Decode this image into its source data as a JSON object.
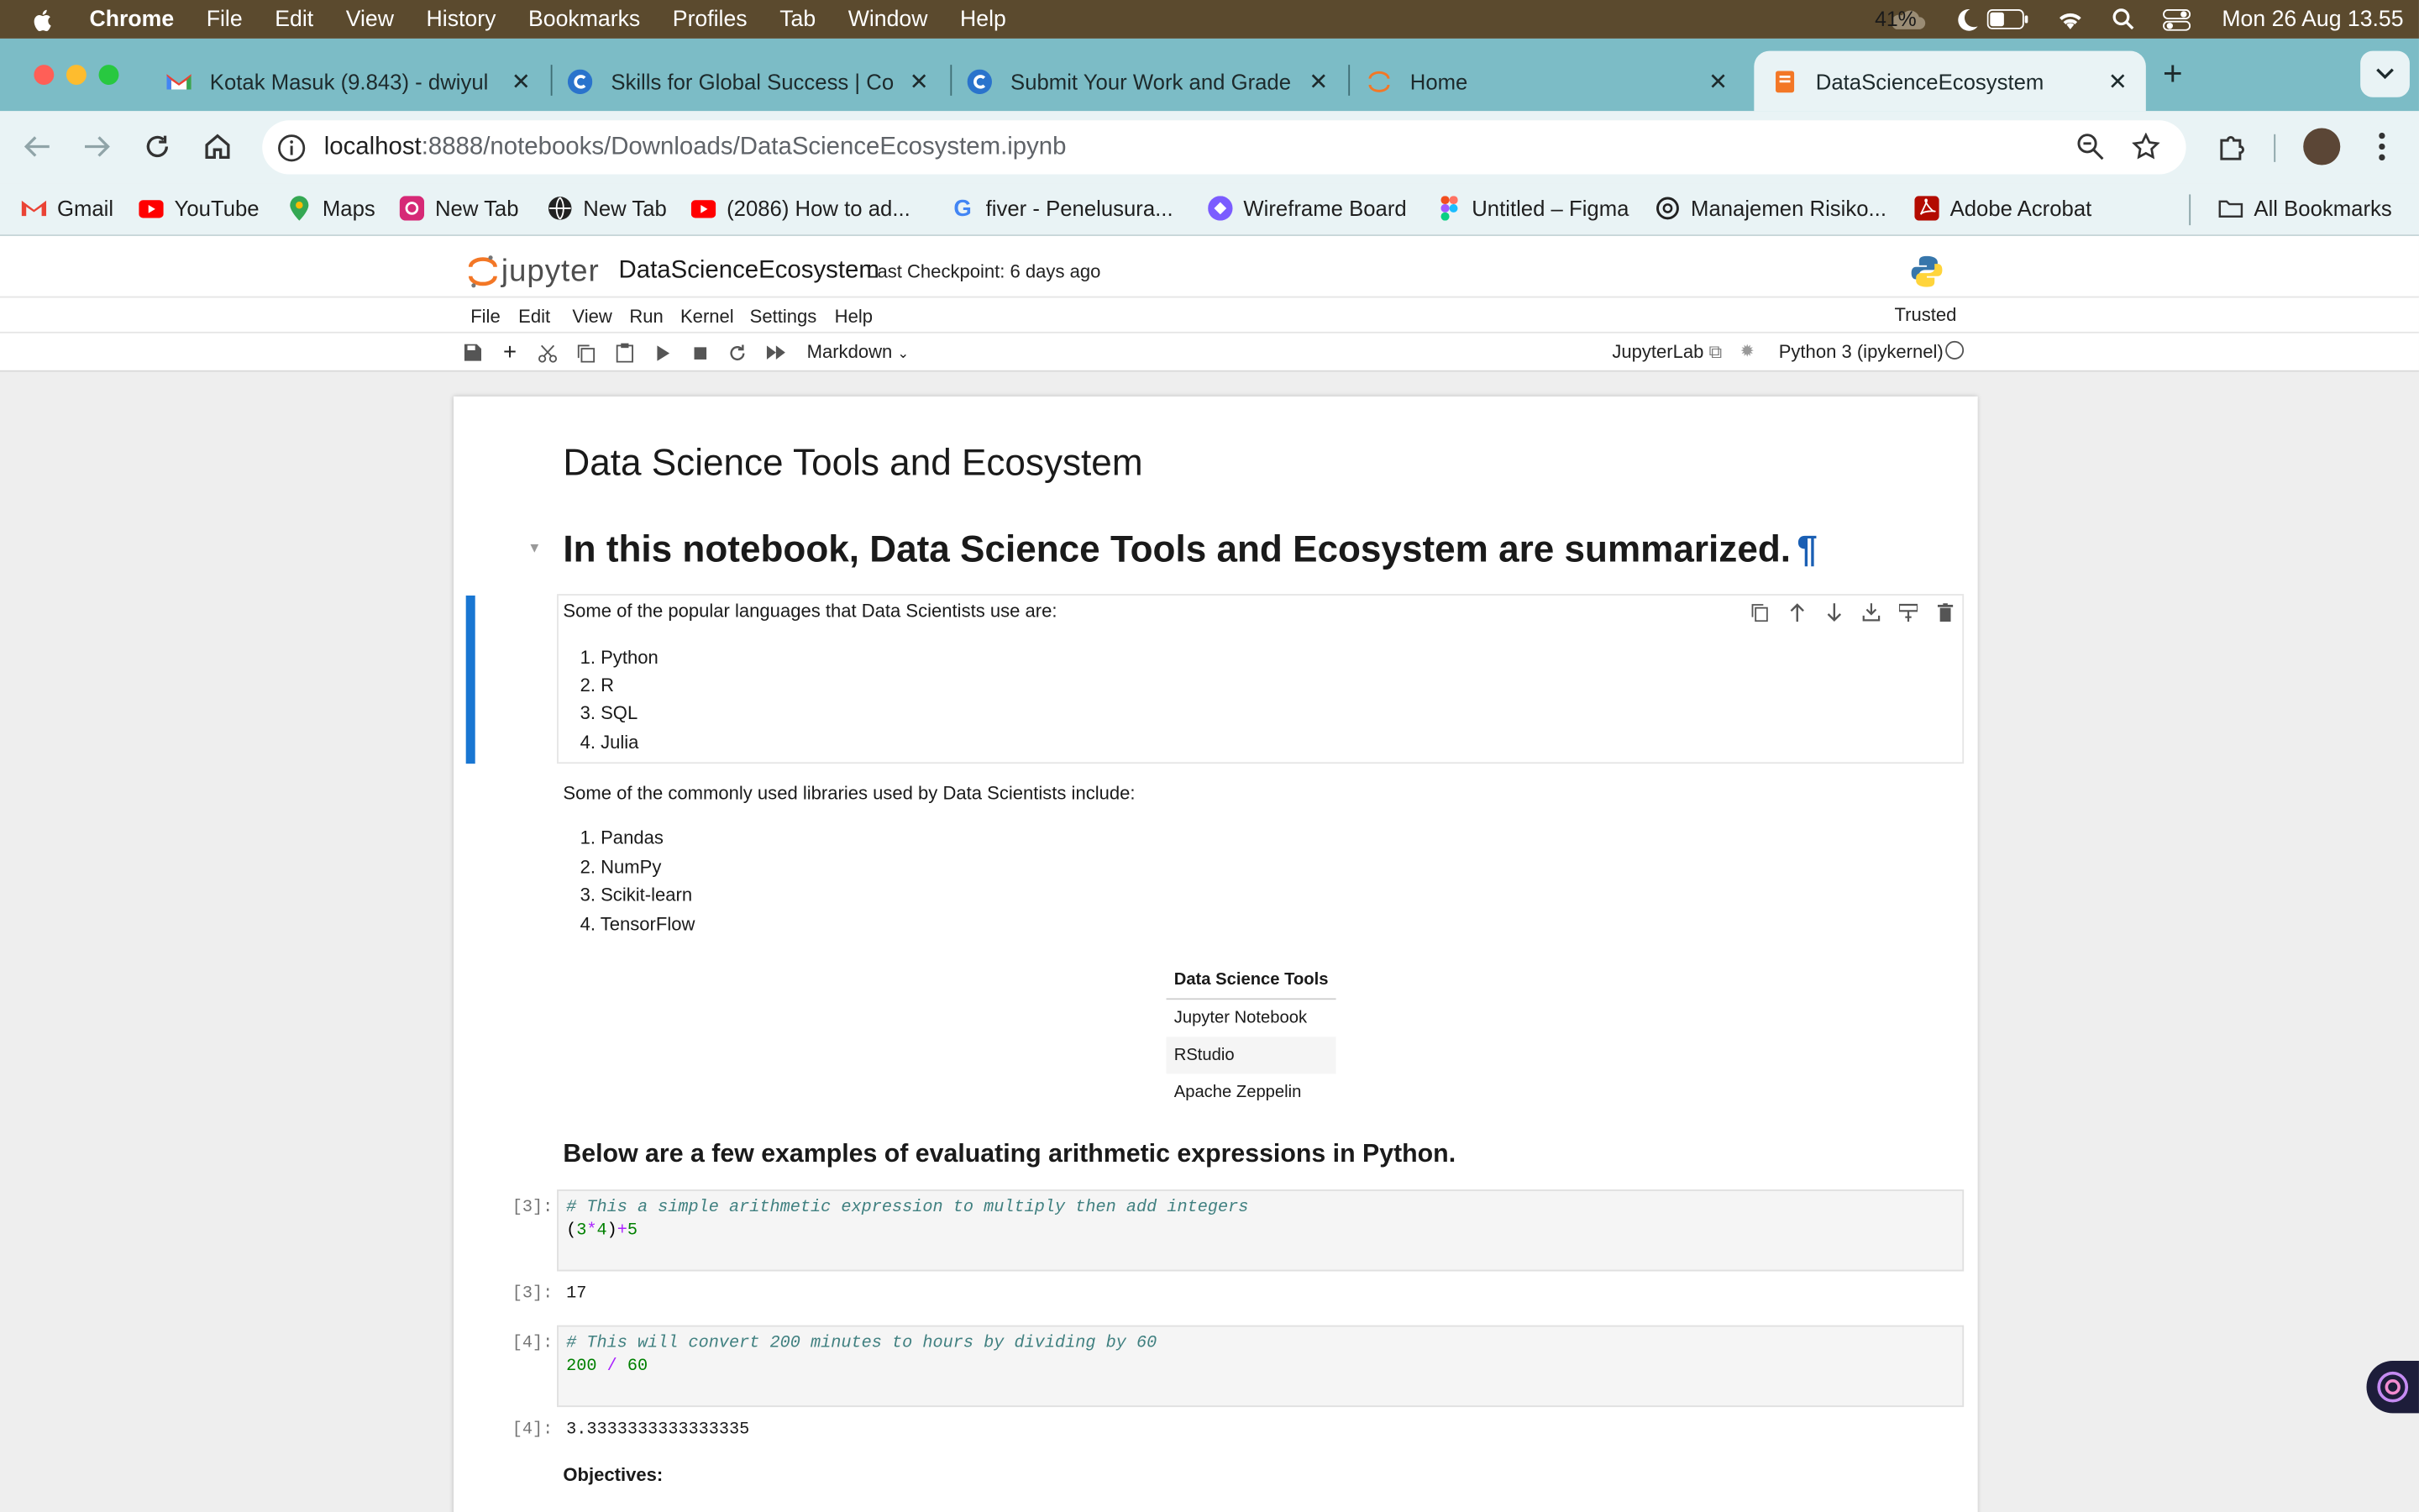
{
  "menubar": {
    "app": "Chrome",
    "items": [
      "File",
      "Edit",
      "View",
      "History",
      "Bookmarks",
      "Profiles",
      "Tab",
      "Window",
      "Help"
    ],
    "battery": "41%",
    "clock": "Mon 26 Aug  13.55"
  },
  "tabs": [
    {
      "title": "Kotak Masuk (9.843) - dwiyul",
      "active": false
    },
    {
      "title": "Skills for Global Success | Co",
      "active": false
    },
    {
      "title": "Submit Your Work and Grade",
      "active": false
    },
    {
      "title": "Home",
      "active": false
    },
    {
      "title": "DataScienceEcosystem",
      "active": true
    }
  ],
  "omnibox": {
    "host": "localhost",
    "path": ":8888/notebooks/Downloads/DataScienceEcosystem.ipynb"
  },
  "bookmarks": [
    "Gmail",
    "YouTube",
    "Maps",
    "New Tab",
    "New Tab",
    "(2086) How to ad...",
    "fiver - Penelusura...",
    "Wireframe Board",
    "Untitled – Figma",
    "Manajemen Risiko...",
    "Adobe Acrobat"
  ],
  "all_bookmarks": "All Bookmarks",
  "jupyter": {
    "logo_text": "jupyter",
    "notebook_title": "DataScienceEcosystem",
    "checkpoint": "Last Checkpoint: 6 days ago",
    "menu": [
      "File",
      "Edit",
      "View",
      "Run",
      "Kernel",
      "Settings",
      "Help"
    ],
    "trusted": "Trusted",
    "cell_type": "Markdown",
    "jupyterlab": "JupyterLab",
    "kernel": "Python 3 (ipykernel)"
  },
  "notebook": {
    "title": "Data Science Tools and Ecosystem",
    "subtitle": "In this notebook, Data Science Tools and Ecosystem are summarized.",
    "pilcrow": "¶",
    "languages_intro": "Some of the popular languages that Data Scientists use are:",
    "languages": [
      "1. Python",
      "2. R",
      "3. SQL",
      "4. Julia"
    ],
    "libraries_intro": "Some of the commonly used libraries used by Data Scientists include:",
    "libraries": [
      "1. Pandas",
      "2. NumPy",
      "3. Scikit-learn",
      "4. TensorFlow"
    ],
    "table_header": "Data Science Tools",
    "table_rows": [
      "Jupyter Notebook",
      "RStudio",
      "Apache Zeppelin"
    ],
    "examples_heading": "Below are a few examples of evaluating arithmetic expressions in Python.",
    "cell1": {
      "prompt": "[3]:",
      "comment": "# This a simple arithmetic expression to multiply then add integers",
      "out_prompt": "[3]:",
      "output": "17"
    },
    "cell2": {
      "prompt": "[4]:",
      "comment": "# This will convert 200 minutes to hours by dividing by 60",
      "out_prompt": "[4]:",
      "output": "3.3333333333333335"
    },
    "objectives": "Objectives:"
  }
}
